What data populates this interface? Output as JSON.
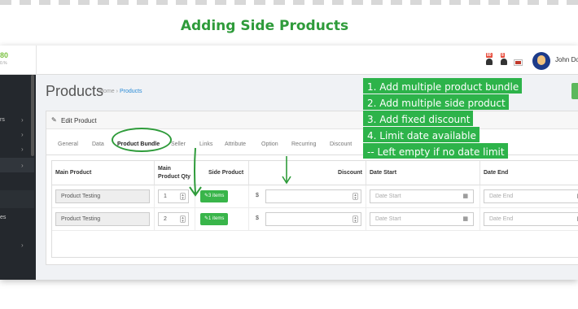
{
  "heading": "Adding Side Products",
  "logo": {
    "text": "80",
    "sub": "0.%"
  },
  "topbar": {
    "badges": [
      "80",
      "8"
    ],
    "user_name": "John Doe"
  },
  "sidebar": {
    "items": [
      "rs",
      "",
      "",
      "",
      "es"
    ]
  },
  "page": {
    "title": "Products",
    "breadcrumb_home": "Home",
    "breadcrumb_sep": "›",
    "breadcrumb_current": "Products"
  },
  "panel": {
    "title": "Edit Product",
    "tabs": [
      "General",
      "Data",
      "Product Bundle",
      "Seller",
      "Links",
      "Attribute",
      "Option",
      "Recurring",
      "Discount"
    ],
    "active_tab": "Product Bundle"
  },
  "table": {
    "headers": {
      "main_product": "Main Product",
      "main_qty_line1": "Main",
      "main_qty_line2": "Product Qty",
      "side_product": "Side Product",
      "discount": "Discount",
      "date_start": "Date Start",
      "date_end": "Date End"
    },
    "currency": "$",
    "date_start_placeholder": "Date Start",
    "date_end_placeholder": "Date End",
    "rows": [
      {
        "main_product": "Product Testing",
        "qty": "1",
        "side_label": "3 items"
      },
      {
        "main_product": "Product Testing",
        "qty": "2",
        "side_label": "1 items"
      }
    ]
  },
  "annotation": {
    "lines": [
      "1. Add multiple product bundle",
      "2. Add multiple side product",
      "3. Add fixed discount",
      "4. Limit date available",
      "-- Left empty if no date limit"
    ]
  },
  "colors": {
    "accent_green": "#2e9b3a",
    "button_green": "#39b54a",
    "sidebar": "#24282d",
    "link_blue": "#2a8bd6"
  },
  "icons": [
    "bell-icon",
    "flag-icon",
    "pencil-icon",
    "calendar-icon",
    "spinner-icon",
    "arrow-down-icon"
  ]
}
